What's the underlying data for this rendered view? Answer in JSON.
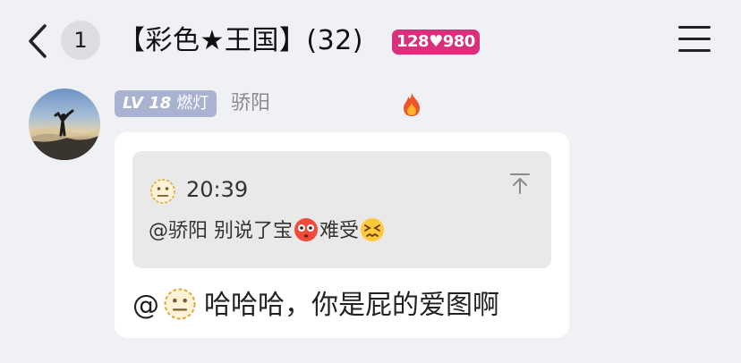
{
  "header": {
    "unread_count": "1",
    "group_title": "【彩色★王国】(32)",
    "group_tag": "128♥980"
  },
  "message": {
    "level_label": "LV 18",
    "level_title": "燃灯",
    "sender_name": "骄阳",
    "quote": {
      "time": "20:39",
      "text_before": "@骄阳 别说了宝",
      "text_middle": "难受"
    },
    "mention_prefix": "@",
    "body_text": "哈哈哈，你是屁的爱图啊"
  },
  "icons": {
    "back": "chevron-left-icon",
    "menu": "hamburger-menu-icon",
    "fire": "fire-icon",
    "neutral_face": "neutral-face-emoji",
    "flushed_face": "flushed-face-emoji",
    "confounded_face": "confounded-face-emoji",
    "jump_to_top": "arrow-to-top-icon"
  },
  "colors": {
    "background": "#f0f1f5",
    "level_badge": "#a9b3d1",
    "group_tag": "#d8307a",
    "quote_bg": "#e9e9e9"
  }
}
